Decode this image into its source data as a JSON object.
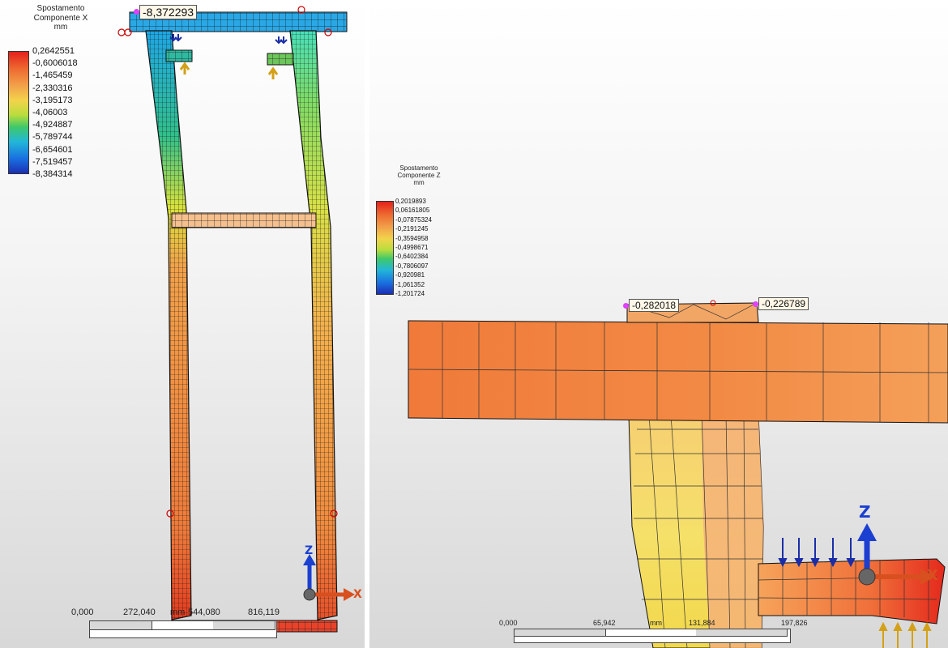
{
  "left_view": {
    "legend": {
      "title_line1": "Spostamento",
      "title_line2": "Componente X",
      "unit": "mm",
      "values": [
        "0,2642551",
        "-0,6006018",
        "-1,465459",
        "-2,330316",
        "-3,195173",
        "-4,06003",
        "-4,924887",
        "-5,789744",
        "-6,654601",
        "-7,519457",
        "-8,384314"
      ]
    },
    "probe": {
      "value": "-8,372293"
    },
    "scale": {
      "labels": [
        "0,000",
        "272,040",
        "544,080",
        "816,119"
      ],
      "unit": "mm"
    },
    "triad": {
      "z": "Z",
      "x": "X"
    }
  },
  "right_view": {
    "legend": {
      "title_line1": "Spostamento",
      "title_line2": "Componente Z",
      "unit": "mm",
      "values": [
        "0,2019893",
        "0,06161805",
        "-0,07875324",
        "-0,2191245",
        "-0,3594958",
        "-0,4998671",
        "-0,6402384",
        "-0,7806097",
        "-0,920981",
        "-1,061352",
        "-1,201724"
      ]
    },
    "probes": [
      {
        "value": "-0,282018"
      },
      {
        "value": "-0,226789"
      }
    ],
    "scale": {
      "labels": [
        "0,000",
        "65,942",
        "mm",
        "131,884",
        "197,826"
      ]
    },
    "triad": {
      "z": "Z",
      "x": "X"
    }
  },
  "colors": {
    "max": "#e4211c",
    "mid": "#b9dd3d",
    "min": "#1c2fb3"
  }
}
